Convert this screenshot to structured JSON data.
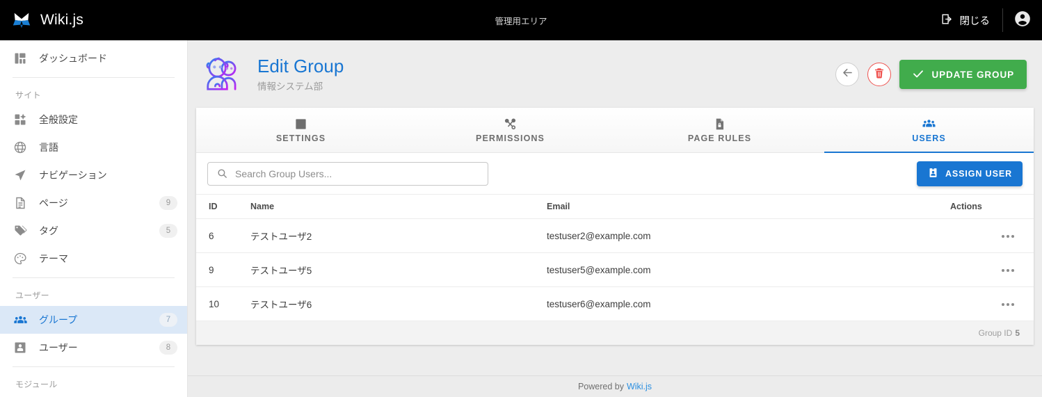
{
  "topbar": {
    "brand": "Wiki.js",
    "brand_logo_icon": "wikijs-butterfly-logo",
    "center_title": "管理用エリア",
    "close_label": "閉じる",
    "close_icon": "exit-to-app-icon",
    "account_icon": "account-circle-icon"
  },
  "sidebar": {
    "items": [
      {
        "label": "ダッシュボード",
        "icon": "dashboard-icon",
        "badge": "",
        "active": false,
        "name": "dashboard"
      }
    ],
    "sections": [
      {
        "title": "サイト",
        "items": [
          {
            "label": "全般設定",
            "icon": "tune-icon",
            "badge": "",
            "active": false,
            "name": "general"
          },
          {
            "label": "言語",
            "icon": "globe-icon",
            "badge": "",
            "active": false,
            "name": "locale"
          },
          {
            "label": "ナビゲーション",
            "icon": "navigation-icon",
            "badge": "",
            "active": false,
            "name": "navigation"
          },
          {
            "label": "ページ",
            "icon": "file-document-icon",
            "badge": "9",
            "active": false,
            "name": "pages"
          },
          {
            "label": "タグ",
            "icon": "tag-icon",
            "badge": "5",
            "active": false,
            "name": "tags"
          },
          {
            "label": "テーマ",
            "icon": "palette-icon",
            "badge": "",
            "active": false,
            "name": "theme"
          }
        ]
      },
      {
        "title": "ユーザー",
        "items": [
          {
            "label": "グループ",
            "icon": "account-group-icon",
            "badge": "7",
            "active": true,
            "name": "groups"
          },
          {
            "label": "ユーザー",
            "icon": "account-box-icon",
            "badge": "8",
            "active": false,
            "name": "users"
          }
        ]
      },
      {
        "title": "モジュール",
        "items": []
      }
    ]
  },
  "page": {
    "icon": "group-people-icon",
    "title": "Edit Group",
    "subtitle": "情報システム部",
    "back_icon": "arrow-left-icon",
    "delete_icon": "trash-can-icon",
    "update_label": "UPDATE GROUP",
    "update_icon": "check-icon"
  },
  "tabs": [
    {
      "label": "SETTINGS",
      "icon": "cog-box-icon",
      "active": false,
      "name": "settings"
    },
    {
      "label": "PERMISSIONS",
      "icon": "shuffle-variant-icon",
      "active": false,
      "name": "permissions"
    },
    {
      "label": "PAGE RULES",
      "icon": "file-lock-icon",
      "active": false,
      "name": "page-rules"
    },
    {
      "label": "USERS",
      "icon": "account-multiple-icon",
      "active": true,
      "name": "users"
    }
  ],
  "toolbar": {
    "search_placeholder": "Search Group Users...",
    "search_value": "",
    "search_icon": "magnify-icon",
    "assign_label": "ASSIGN USER",
    "assign_icon": "account-badge-icon"
  },
  "table": {
    "columns": [
      "ID",
      "Name",
      "Email",
      "Actions"
    ],
    "rows": [
      {
        "id": "6",
        "name": "テストユーザ2",
        "email": "testuser2@example.com",
        "actions_icon": "dots-horizontal-icon"
      },
      {
        "id": "9",
        "name": "テストユーザ5",
        "email": "testuser5@example.com",
        "actions_icon": "dots-horizontal-icon"
      },
      {
        "id": "10",
        "name": "テストユーザ6",
        "email": "testuser6@example.com",
        "actions_icon": "dots-horizontal-icon"
      }
    ]
  },
  "card_footer": {
    "group_id_label": "Group ID",
    "group_id_value": "5"
  },
  "page_footer": {
    "powered_by": "Powered by",
    "link": "Wiki.js"
  },
  "colors": {
    "accent_blue": "#1976d2",
    "green": "#41ac4c",
    "red": "#ef5350",
    "topbar_black": "#000000",
    "page_bg": "#ededed"
  }
}
